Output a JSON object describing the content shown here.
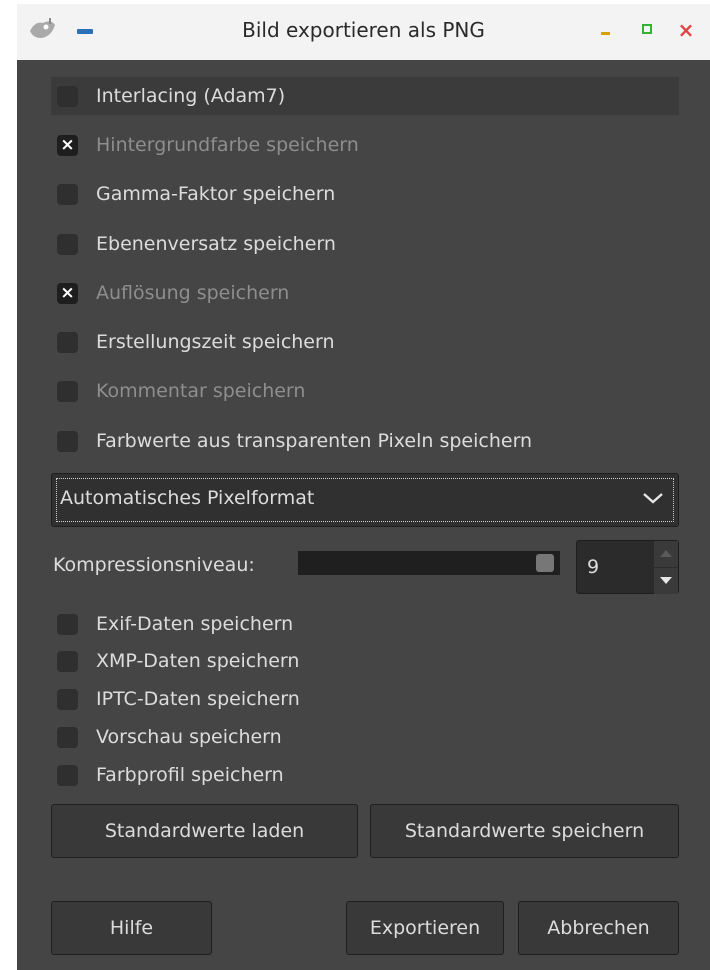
{
  "window": {
    "title": "Bild exportieren als PNG",
    "close_glyph": "×"
  },
  "options": [
    {
      "label": "Interlacing (Adam7)",
      "checked": false,
      "dim": false,
      "highlight": true
    },
    {
      "label": "Hintergrundfarbe speichern",
      "checked": true,
      "dim": true
    },
    {
      "label": "Gamma-Faktor speichern",
      "checked": false,
      "dim": false
    },
    {
      "label": "Ebenenversatz speichern",
      "checked": false,
      "dim": false
    },
    {
      "label": "Auflösung speichern",
      "checked": true,
      "dim": true
    },
    {
      "label": "Erstellungszeit speichern",
      "checked": false,
      "dim": false
    },
    {
      "label": "Kommentar speichern",
      "checked": false,
      "dim": true
    },
    {
      "label": "Farbwerte aus transparenten Pixeln speichern",
      "checked": false,
      "dim": false
    }
  ],
  "check_mark": "×",
  "pixel_format": {
    "selected": "Automatisches Pixelformat"
  },
  "compression": {
    "label": "Kompressionsniveau:",
    "value": "9",
    "max": 9
  },
  "metadata": [
    {
      "label": "Exif-Daten speichern",
      "checked": false
    },
    {
      "label": "XMP-Daten speichern",
      "checked": false
    },
    {
      "label": "IPTC-Daten speichern",
      "checked": false
    },
    {
      "label": "Vorschau speichern",
      "checked": false
    },
    {
      "label": "Farbprofil speichern",
      "checked": false
    }
  ],
  "buttons": {
    "load_defaults": "Standardwerte laden",
    "save_defaults": "Standardwerte speichern",
    "help": "Hilfe",
    "export": "Exportieren",
    "cancel": "Abbrechen"
  },
  "colors": {
    "dialog_bg": "#454545",
    "titlebar_bg": "#f3f3f3",
    "minimize": "#d6a200",
    "maximize": "#33b233",
    "close": "#e04545"
  }
}
